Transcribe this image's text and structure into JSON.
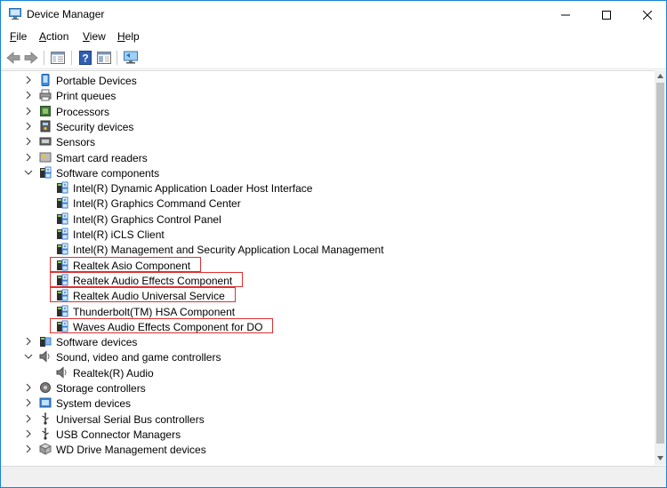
{
  "window": {
    "title": "Device Manager"
  },
  "menu": {
    "file": "File",
    "action": "Action",
    "view": "View",
    "help": "Help"
  },
  "tree": [
    {
      "label": "Portable Devices",
      "level": 0,
      "expander": "collapsed",
      "icon": "portable-device-icon"
    },
    {
      "label": "Print queues",
      "level": 0,
      "expander": "collapsed",
      "icon": "printer-icon"
    },
    {
      "label": "Processors",
      "level": 0,
      "expander": "collapsed",
      "icon": "processor-icon"
    },
    {
      "label": "Security devices",
      "level": 0,
      "expander": "collapsed",
      "icon": "security-device-icon"
    },
    {
      "label": "Sensors",
      "level": 0,
      "expander": "collapsed",
      "icon": "sensor-icon"
    },
    {
      "label": "Smart card readers",
      "level": 0,
      "expander": "collapsed",
      "icon": "smart-card-reader-icon"
    },
    {
      "label": "Software components",
      "level": 0,
      "expander": "expanded",
      "icon": "software-component-icon"
    },
    {
      "label": "Intel(R) Dynamic Application Loader Host Interface",
      "level": 1,
      "icon": "software-component-icon"
    },
    {
      "label": "Intel(R) Graphics Command Center",
      "level": 1,
      "icon": "software-component-icon"
    },
    {
      "label": "Intel(R) Graphics Control Panel",
      "level": 1,
      "icon": "software-component-icon"
    },
    {
      "label": "Intel(R) iCLS Client",
      "level": 1,
      "icon": "software-component-icon"
    },
    {
      "label": "Intel(R) Management and Security Application Local Management",
      "level": 1,
      "icon": "software-component-icon"
    },
    {
      "label": "Realtek Asio Component",
      "level": 1,
      "icon": "software-component-icon",
      "highlight": true
    },
    {
      "label": "Realtek Audio Effects Component",
      "level": 1,
      "icon": "software-component-icon",
      "highlight": true
    },
    {
      "label": "Realtek Audio Universal Service",
      "level": 1,
      "icon": "software-component-icon",
      "highlight": true
    },
    {
      "label": "Thunderbolt(TM) HSA Component",
      "level": 1,
      "icon": "software-component-icon"
    },
    {
      "label": "Waves Audio Effects Component for DO",
      "level": 1,
      "icon": "software-component-icon",
      "highlight": true
    },
    {
      "label": "Software devices",
      "level": 0,
      "expander": "collapsed",
      "icon": "software-device-icon"
    },
    {
      "label": "Sound, video and game controllers",
      "level": 0,
      "expander": "expanded",
      "icon": "speaker-icon"
    },
    {
      "label": "Realtek(R) Audio",
      "level": 1,
      "icon": "speaker-icon"
    },
    {
      "label": "Storage controllers",
      "level": 0,
      "expander": "collapsed",
      "icon": "storage-controller-icon"
    },
    {
      "label": "System devices",
      "level": 0,
      "expander": "collapsed",
      "icon": "system-device-icon"
    },
    {
      "label": "Universal Serial Bus controllers",
      "level": 0,
      "expander": "collapsed",
      "icon": "usb-icon"
    },
    {
      "label": "USB Connector Managers",
      "level": 0,
      "expander": "collapsed",
      "icon": "usb-icon"
    },
    {
      "label": "WD Drive Management devices",
      "level": 0,
      "expander": "collapsed",
      "icon": "wd-drive-icon"
    }
  ],
  "colors": {
    "accent_border": "#1883d7",
    "highlight_box": "#e0302f"
  }
}
